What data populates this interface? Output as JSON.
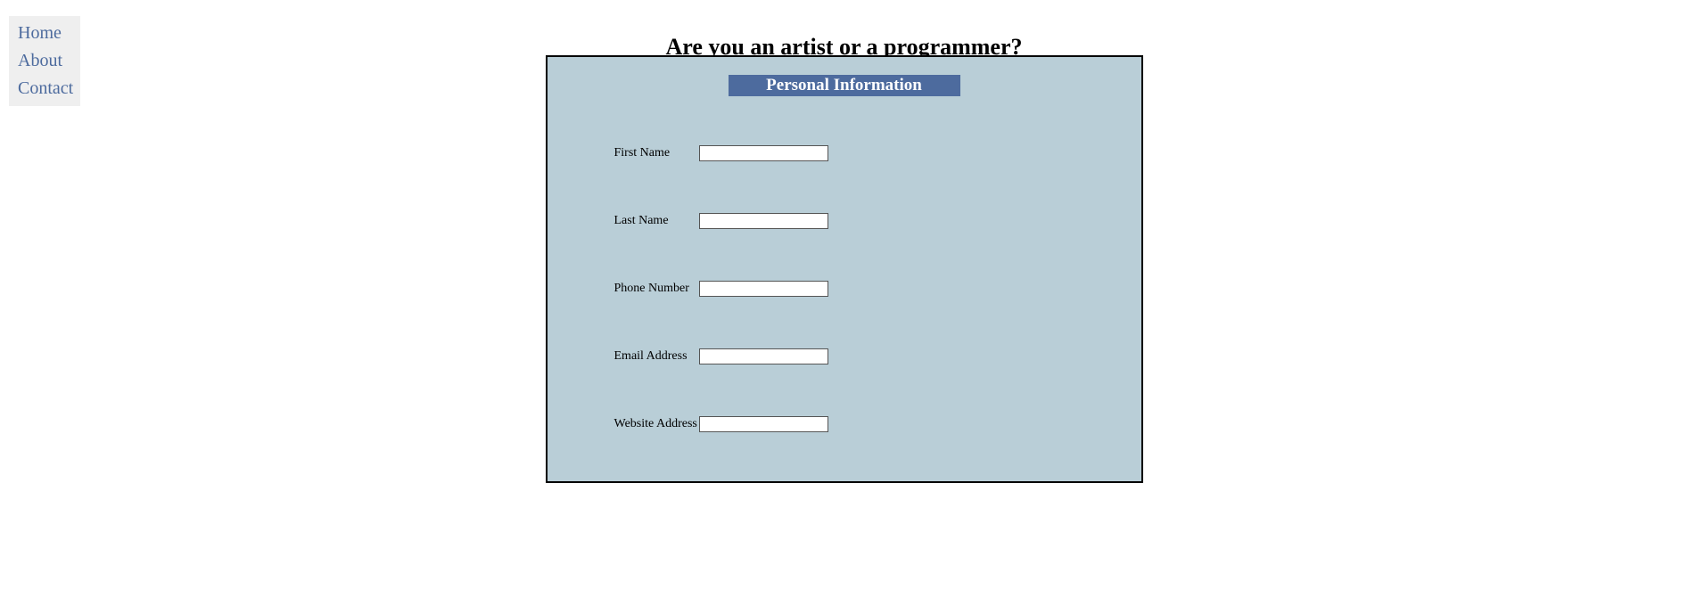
{
  "nav": {
    "items": [
      {
        "label": "Home"
      },
      {
        "label": "About"
      },
      {
        "label": "Contact"
      }
    ]
  },
  "page": {
    "title": "Are you an artist or a programmer?"
  },
  "form": {
    "header": "Personal Information",
    "fields": [
      {
        "label": "First Name",
        "value": ""
      },
      {
        "label": "Last Name",
        "value": ""
      },
      {
        "label": "Phone Number",
        "value": ""
      },
      {
        "label": "Email Address",
        "value": ""
      },
      {
        "label": "Website Address",
        "value": ""
      }
    ]
  }
}
